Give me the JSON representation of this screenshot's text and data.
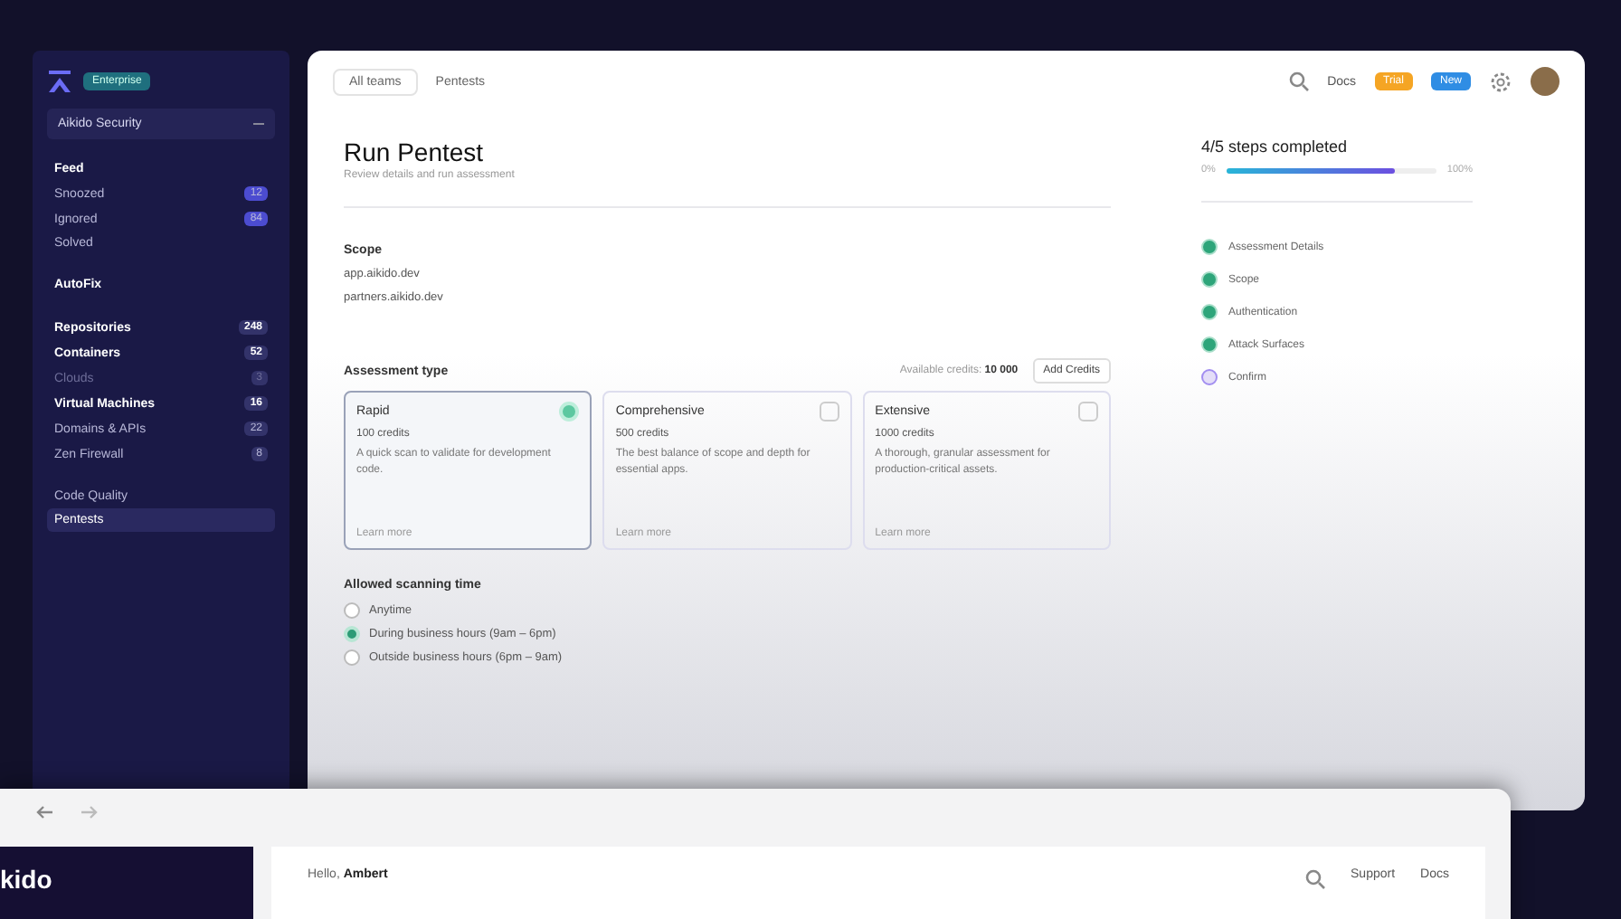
{
  "back_window": {
    "sidebar": {
      "workspace_badge": "Enterprise",
      "workspace": "Aikido Security",
      "items": [
        {
          "label": "Feed",
          "kind": "heading",
          "selected": false
        },
        {
          "label": "Snoozed",
          "count": "12",
          "kind": "item",
          "selected": false
        },
        {
          "label": "Ignored",
          "count": "84",
          "kind": "item",
          "selected": false
        },
        {
          "label": "Solved",
          "kind": "item",
          "selected": false
        },
        {
          "label": "AutoFix",
          "kind": "heading",
          "selected": false
        },
        {
          "label": "Repositories",
          "count": "248",
          "kind": "heading",
          "selected": false
        },
        {
          "label": "Containers",
          "count": "52",
          "kind": "heading",
          "selected": false
        },
        {
          "label": "Clouds",
          "count": "3",
          "kind": "dim",
          "selected": false
        },
        {
          "label": "Virtual Machines",
          "count": "16",
          "kind": "heading",
          "selected": false
        },
        {
          "label": "Domains & APIs",
          "count": "22",
          "kind": "item",
          "selected": false
        },
        {
          "label": "Zen Firewall",
          "count": "8",
          "kind": "item",
          "selected": false
        },
        {
          "label": "Code Quality",
          "kind": "item",
          "selected": false
        },
        {
          "label": "Pentests",
          "kind": "item",
          "selected": true
        }
      ]
    },
    "topbar": {
      "team_filter": "All teams",
      "breadcrumb": "Pentests",
      "docs": "Docs",
      "trial_badge": "Trial",
      "new_badge": "New"
    },
    "title": "Run Pentest",
    "subtitle": "Review details and run assessment",
    "scope": {
      "label": "Scope",
      "domains": [
        "app.aikido.dev",
        "partners.aikido.dev"
      ]
    },
    "assessment": {
      "label": "Assessment type",
      "credits_label": "Available credits:",
      "credits": "10 000",
      "add_button": "Add Credits",
      "options": [
        {
          "name": "Rapid",
          "credits": "100 credits",
          "description": "A quick scan to validate for development code.",
          "link": "Learn more",
          "selected": true
        },
        {
          "name": "Comprehensive",
          "credits": "500 credits",
          "description": "The best balance of scope and depth for essential apps.",
          "link": "Learn more",
          "selected": false
        },
        {
          "name": "Extensive",
          "credits": "1000 credits",
          "description": "A thorough, granular assessment for production-critical assets.",
          "link": "Learn more",
          "selected": false
        }
      ]
    },
    "scanning_time": {
      "label": "Allowed scanning time",
      "options": [
        {
          "label": "Anytime",
          "selected": false
        },
        {
          "label": "During business hours (9am – 6pm)",
          "selected": true
        },
        {
          "label": "Outside business hours (6pm – 9am)",
          "selected": false
        }
      ]
    },
    "progress": {
      "title": "4/5 steps completed",
      "start": "0%",
      "end": "100%",
      "level": 0.8,
      "steps": [
        {
          "label": "Assessment Details",
          "done": true
        },
        {
          "label": "Scope",
          "done": true
        },
        {
          "label": "Authentication",
          "done": true
        },
        {
          "label": "Attack Surfaces",
          "done": true
        },
        {
          "label": "Confirm",
          "done": false
        }
      ]
    }
  },
  "front_window": {
    "sidebar_brand": "kido",
    "greeting": "Hello, **Ambert**",
    "support": "Support",
    "docs": "Docs"
  }
}
